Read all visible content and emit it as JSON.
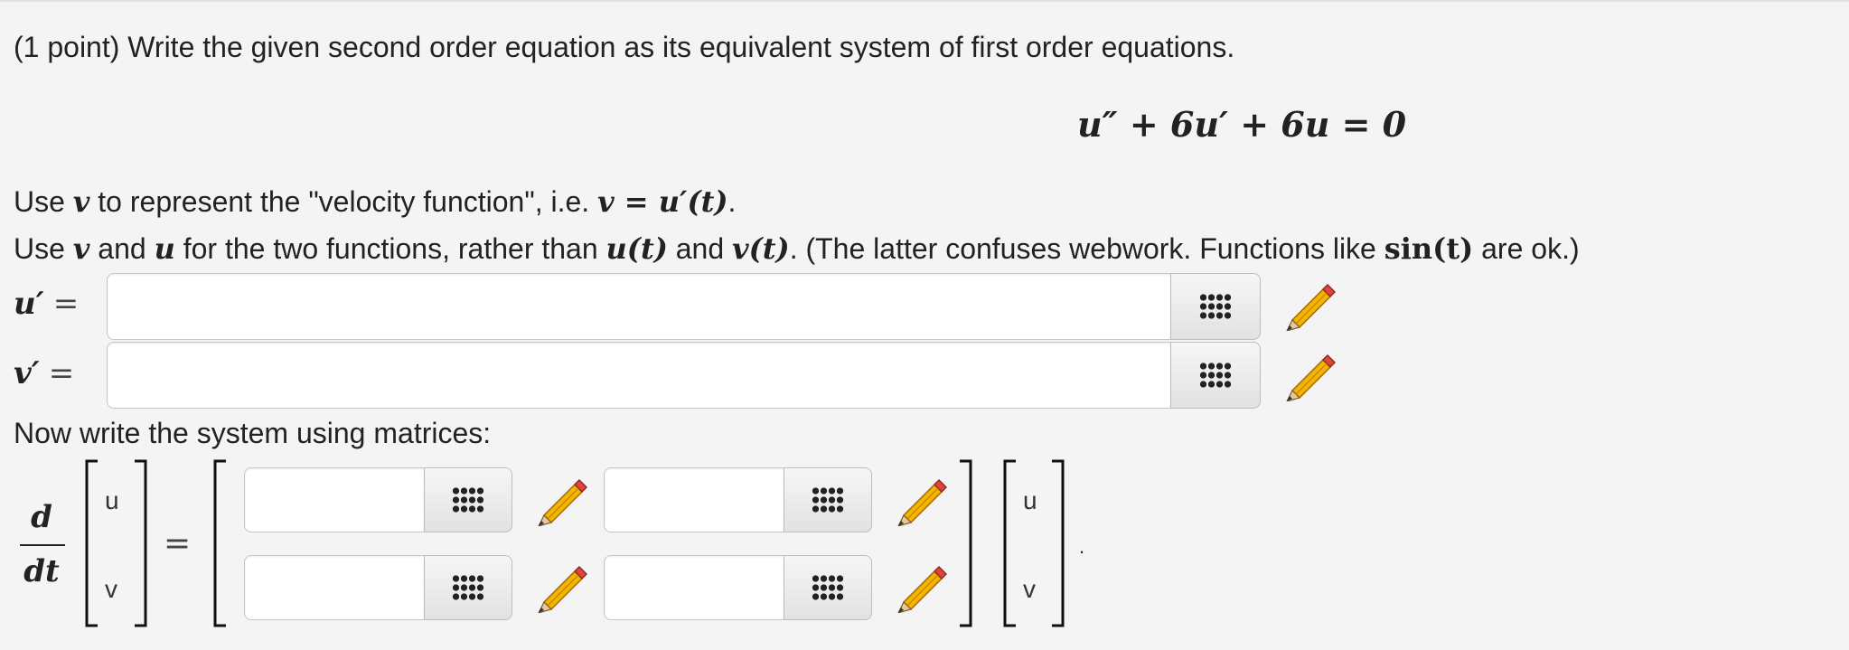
{
  "problem": {
    "intro": "(1 point) Write the given second order equation as its equivalent system of first order equations.",
    "equation": "u″ + 6u′ + 6u = 0",
    "line1": {
      "pre": "Use ",
      "var_v": "v",
      "mid": " to represent the \"velocity function\", i.e. ",
      "math": "v = u′(t)",
      "post": "."
    },
    "line2": {
      "pre": "Use ",
      "v": "v",
      "and1": " and ",
      "u": "u",
      "mid": " for the two functions, rather than ",
      "ut": "u(t)",
      "and2": " and ",
      "vt": "v(t)",
      "post": ". (The latter confuses webwork. Functions like ",
      "sint": "sin(t)",
      "end": " are ok.)"
    },
    "uprime_label": "u′",
    "vprime_label": "v′",
    "equals": "=",
    "matrix_intro": "Now write the system using matrices:",
    "d": "d",
    "dt": "dt",
    "vec_top": "u",
    "vec_bottom": "v",
    "trailing_dot": "."
  },
  "inputs": {
    "uprime": "",
    "vprime": "",
    "m11": "",
    "m12": "",
    "m21": "",
    "m22": ""
  },
  "icons": {
    "palette": "grid-palette-icon",
    "pencil": "pencil-icon"
  }
}
